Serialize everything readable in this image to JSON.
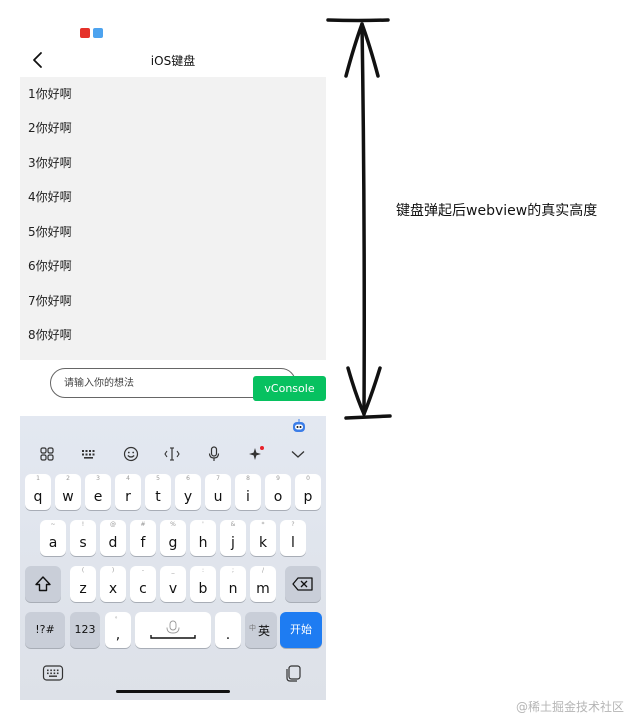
{
  "nav": {
    "title": "iOS键盘"
  },
  "list": {
    "items": [
      "1你好啊",
      "2你好啊",
      "3你好啊",
      "4你好啊",
      "5你好啊",
      "6你好啊",
      "7你好啊",
      "8你好啊"
    ]
  },
  "input": {
    "placeholder": "请输入你的想法",
    "value": ""
  },
  "vconsole": {
    "label": "vConsole"
  },
  "keyboard": {
    "toolbar_icons": [
      "apps-grid-icon",
      "keyboard-switch-icon",
      "emoji-icon",
      "cursor-icon",
      "microphone-icon",
      "magic-icon",
      "chevron-down-icon"
    ],
    "row1": [
      {
        "key": "q",
        "hint": "1"
      },
      {
        "key": "w",
        "hint": "2"
      },
      {
        "key": "e",
        "hint": "3"
      },
      {
        "key": "r",
        "hint": "4"
      },
      {
        "key": "t",
        "hint": "5"
      },
      {
        "key": "y",
        "hint": "6"
      },
      {
        "key": "u",
        "hint": "7"
      },
      {
        "key": "i",
        "hint": "8"
      },
      {
        "key": "o",
        "hint": "9"
      },
      {
        "key": "p",
        "hint": "0"
      }
    ],
    "row2": [
      {
        "key": "a",
        "hint": "~"
      },
      {
        "key": "s",
        "hint": "!"
      },
      {
        "key": "d",
        "hint": "@"
      },
      {
        "key": "f",
        "hint": "#"
      },
      {
        "key": "g",
        "hint": "%"
      },
      {
        "key": "h",
        "hint": "'"
      },
      {
        "key": "j",
        "hint": "&"
      },
      {
        "key": "k",
        "hint": "*"
      },
      {
        "key": "l",
        "hint": "?"
      }
    ],
    "row3": [
      {
        "key": "z",
        "hint": "("
      },
      {
        "key": "x",
        "hint": ")"
      },
      {
        "key": "c",
        "hint": "-"
      },
      {
        "key": "v",
        "hint": "_"
      },
      {
        "key": "b",
        "hint": ":"
      },
      {
        "key": "n",
        "hint": ";"
      },
      {
        "key": "m",
        "hint": "/"
      }
    ],
    "symbols_label": "!?#",
    "numbers_label": "123",
    "comma": {
      "key": ",",
      "hint": "。"
    },
    "period_label": ".",
    "lang_label": "英",
    "lang_hint": "中",
    "go_label": "开始"
  },
  "annotation": {
    "text": "键盘弹起后webview的真实高度"
  },
  "watermark": {
    "text": "@稀土掘金技术社区"
  },
  "colors": {
    "vconsole_green": "#07c160",
    "go_blue": "#1e7cf2"
  }
}
